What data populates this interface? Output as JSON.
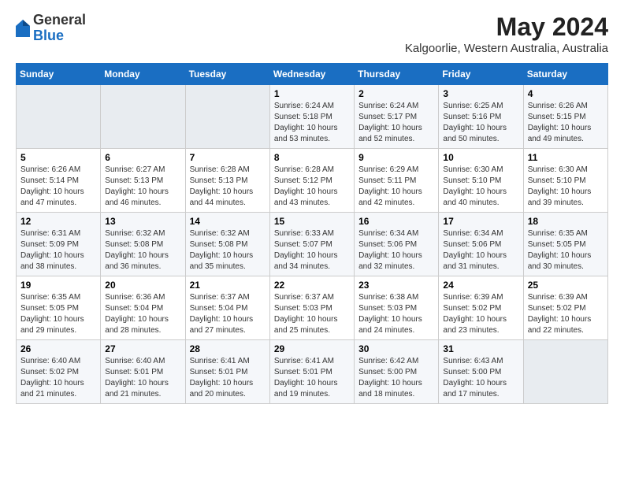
{
  "header": {
    "logo_line1": "General",
    "logo_line2": "Blue",
    "title": "May 2024",
    "subtitle": "Kalgoorlie, Western Australia, Australia"
  },
  "days_of_week": [
    "Sunday",
    "Monday",
    "Tuesday",
    "Wednesday",
    "Thursday",
    "Friday",
    "Saturday"
  ],
  "weeks": [
    [
      {
        "day": "",
        "empty": true
      },
      {
        "day": "",
        "empty": true
      },
      {
        "day": "",
        "empty": true
      },
      {
        "day": "1",
        "sunrise": "Sunrise: 6:24 AM",
        "sunset": "Sunset: 5:18 PM",
        "daylight": "Daylight: 10 hours and 53 minutes."
      },
      {
        "day": "2",
        "sunrise": "Sunrise: 6:24 AM",
        "sunset": "Sunset: 5:17 PM",
        "daylight": "Daylight: 10 hours and 52 minutes."
      },
      {
        "day": "3",
        "sunrise": "Sunrise: 6:25 AM",
        "sunset": "Sunset: 5:16 PM",
        "daylight": "Daylight: 10 hours and 50 minutes."
      },
      {
        "day": "4",
        "sunrise": "Sunrise: 6:26 AM",
        "sunset": "Sunset: 5:15 PM",
        "daylight": "Daylight: 10 hours and 49 minutes."
      }
    ],
    [
      {
        "day": "5",
        "sunrise": "Sunrise: 6:26 AM",
        "sunset": "Sunset: 5:14 PM",
        "daylight": "Daylight: 10 hours and 47 minutes."
      },
      {
        "day": "6",
        "sunrise": "Sunrise: 6:27 AM",
        "sunset": "Sunset: 5:13 PM",
        "daylight": "Daylight: 10 hours and 46 minutes."
      },
      {
        "day": "7",
        "sunrise": "Sunrise: 6:28 AM",
        "sunset": "Sunset: 5:13 PM",
        "daylight": "Daylight: 10 hours and 44 minutes."
      },
      {
        "day": "8",
        "sunrise": "Sunrise: 6:28 AM",
        "sunset": "Sunset: 5:12 PM",
        "daylight": "Daylight: 10 hours and 43 minutes."
      },
      {
        "day": "9",
        "sunrise": "Sunrise: 6:29 AM",
        "sunset": "Sunset: 5:11 PM",
        "daylight": "Daylight: 10 hours and 42 minutes."
      },
      {
        "day": "10",
        "sunrise": "Sunrise: 6:30 AM",
        "sunset": "Sunset: 5:10 PM",
        "daylight": "Daylight: 10 hours and 40 minutes."
      },
      {
        "day": "11",
        "sunrise": "Sunrise: 6:30 AM",
        "sunset": "Sunset: 5:10 PM",
        "daylight": "Daylight: 10 hours and 39 minutes."
      }
    ],
    [
      {
        "day": "12",
        "sunrise": "Sunrise: 6:31 AM",
        "sunset": "Sunset: 5:09 PM",
        "daylight": "Daylight: 10 hours and 38 minutes."
      },
      {
        "day": "13",
        "sunrise": "Sunrise: 6:32 AM",
        "sunset": "Sunset: 5:08 PM",
        "daylight": "Daylight: 10 hours and 36 minutes."
      },
      {
        "day": "14",
        "sunrise": "Sunrise: 6:32 AM",
        "sunset": "Sunset: 5:08 PM",
        "daylight": "Daylight: 10 hours and 35 minutes."
      },
      {
        "day": "15",
        "sunrise": "Sunrise: 6:33 AM",
        "sunset": "Sunset: 5:07 PM",
        "daylight": "Daylight: 10 hours and 34 minutes."
      },
      {
        "day": "16",
        "sunrise": "Sunrise: 6:34 AM",
        "sunset": "Sunset: 5:06 PM",
        "daylight": "Daylight: 10 hours and 32 minutes."
      },
      {
        "day": "17",
        "sunrise": "Sunrise: 6:34 AM",
        "sunset": "Sunset: 5:06 PM",
        "daylight": "Daylight: 10 hours and 31 minutes."
      },
      {
        "day": "18",
        "sunrise": "Sunrise: 6:35 AM",
        "sunset": "Sunset: 5:05 PM",
        "daylight": "Daylight: 10 hours and 30 minutes."
      }
    ],
    [
      {
        "day": "19",
        "sunrise": "Sunrise: 6:35 AM",
        "sunset": "Sunset: 5:05 PM",
        "daylight": "Daylight: 10 hours and 29 minutes."
      },
      {
        "day": "20",
        "sunrise": "Sunrise: 6:36 AM",
        "sunset": "Sunset: 5:04 PM",
        "daylight": "Daylight: 10 hours and 28 minutes."
      },
      {
        "day": "21",
        "sunrise": "Sunrise: 6:37 AM",
        "sunset": "Sunset: 5:04 PM",
        "daylight": "Daylight: 10 hours and 27 minutes."
      },
      {
        "day": "22",
        "sunrise": "Sunrise: 6:37 AM",
        "sunset": "Sunset: 5:03 PM",
        "daylight": "Daylight: 10 hours and 25 minutes."
      },
      {
        "day": "23",
        "sunrise": "Sunrise: 6:38 AM",
        "sunset": "Sunset: 5:03 PM",
        "daylight": "Daylight: 10 hours and 24 minutes."
      },
      {
        "day": "24",
        "sunrise": "Sunrise: 6:39 AM",
        "sunset": "Sunset: 5:02 PM",
        "daylight": "Daylight: 10 hours and 23 minutes."
      },
      {
        "day": "25",
        "sunrise": "Sunrise: 6:39 AM",
        "sunset": "Sunset: 5:02 PM",
        "daylight": "Daylight: 10 hours and 22 minutes."
      }
    ],
    [
      {
        "day": "26",
        "sunrise": "Sunrise: 6:40 AM",
        "sunset": "Sunset: 5:02 PM",
        "daylight": "Daylight: 10 hours and 21 minutes."
      },
      {
        "day": "27",
        "sunrise": "Sunrise: 6:40 AM",
        "sunset": "Sunset: 5:01 PM",
        "daylight": "Daylight: 10 hours and 21 minutes."
      },
      {
        "day": "28",
        "sunrise": "Sunrise: 6:41 AM",
        "sunset": "Sunset: 5:01 PM",
        "daylight": "Daylight: 10 hours and 20 minutes."
      },
      {
        "day": "29",
        "sunrise": "Sunrise: 6:41 AM",
        "sunset": "Sunset: 5:01 PM",
        "daylight": "Daylight: 10 hours and 19 minutes."
      },
      {
        "day": "30",
        "sunrise": "Sunrise: 6:42 AM",
        "sunset": "Sunset: 5:00 PM",
        "daylight": "Daylight: 10 hours and 18 minutes."
      },
      {
        "day": "31",
        "sunrise": "Sunrise: 6:43 AM",
        "sunset": "Sunset: 5:00 PM",
        "daylight": "Daylight: 10 hours and 17 minutes."
      },
      {
        "day": "",
        "empty": true
      }
    ]
  ]
}
